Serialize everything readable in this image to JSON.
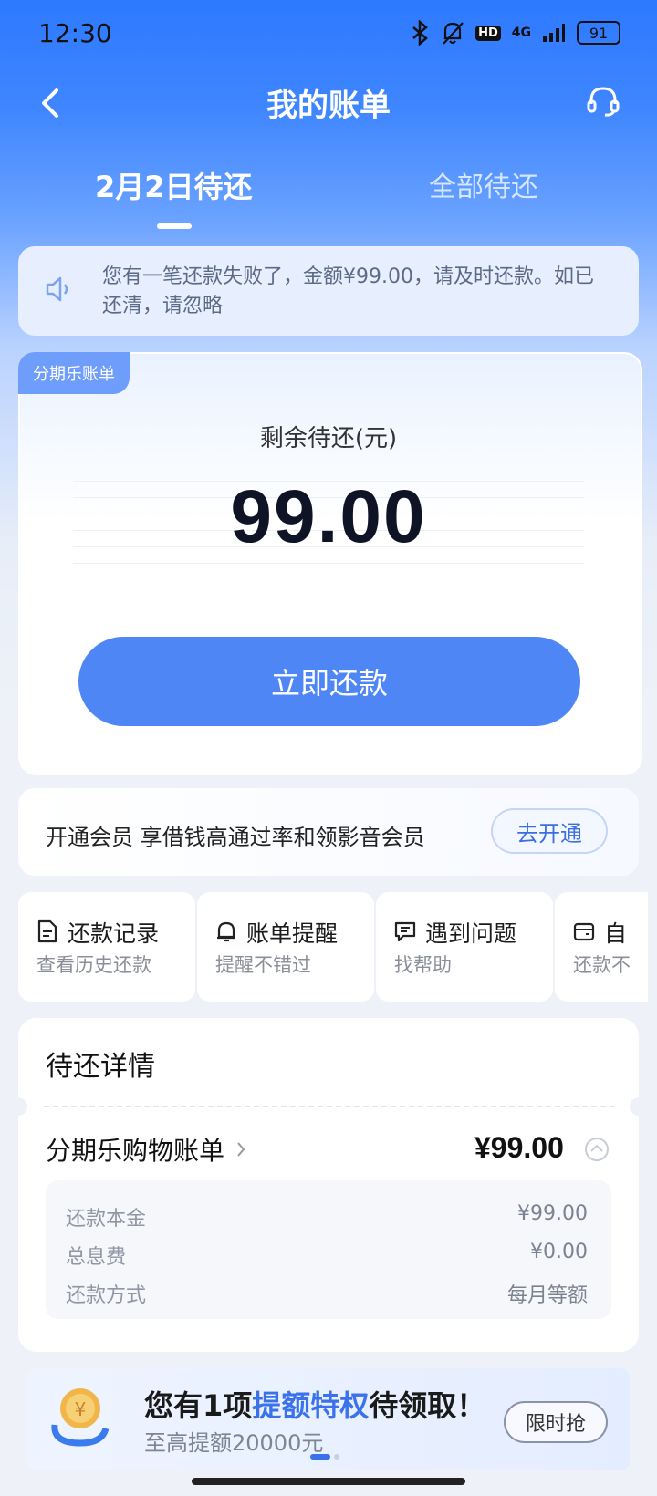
{
  "status_bar": {
    "time": "12:30",
    "network": "4G",
    "hd": "HD",
    "battery": "91"
  },
  "header": {
    "title": "我的账单",
    "back_icon": "chevron-left-icon",
    "service_icon": "headset-icon"
  },
  "tabs": [
    {
      "label": "2月2日待还",
      "active": true
    },
    {
      "label": "全部待还",
      "active": false
    }
  ],
  "notice": {
    "text": "您有一笔还款失败了，金额¥99.00，请及时还款。如已还清，请忽略",
    "icon": "speaker-icon"
  },
  "bill_card": {
    "tag": "分期乐账单",
    "remaining_label": "剩余待还(元)",
    "amount": "99.00",
    "pay_button": "立即还款"
  },
  "membership": {
    "text": "开通会员 享借钱高通过率和领影音会员",
    "button": "去开通"
  },
  "shortcuts": [
    {
      "title": "还款记录",
      "subtitle": "查看历史还款",
      "icon": "document-icon"
    },
    {
      "title": "账单提醒",
      "subtitle": "提醒不错过",
      "icon": "bell-icon"
    },
    {
      "title": "遇到问题",
      "subtitle": "找帮助",
      "icon": "message-icon"
    },
    {
      "title": "自",
      "subtitle": "还款不",
      "icon": "wallet-icon"
    }
  ],
  "details": {
    "title": "待还详情",
    "bill_name": "分期乐购物账单",
    "bill_amount": "¥99.00",
    "rows": [
      {
        "label": "还款本金",
        "value": "¥99.00"
      },
      {
        "label": "总息费",
        "value": "¥0.00"
      },
      {
        "label": "还款方式",
        "value": "每月等额"
      }
    ]
  },
  "promo": {
    "text_before": "您有1项",
    "highlight": "提额特权",
    "text_after": "待领取！",
    "subtitle": "至高提额20000元",
    "button": "限时抢"
  },
  "colors": {
    "primary": "#4f86f6",
    "accent_text": "#3b72ec",
    "header_bg": "#2d79ff"
  }
}
